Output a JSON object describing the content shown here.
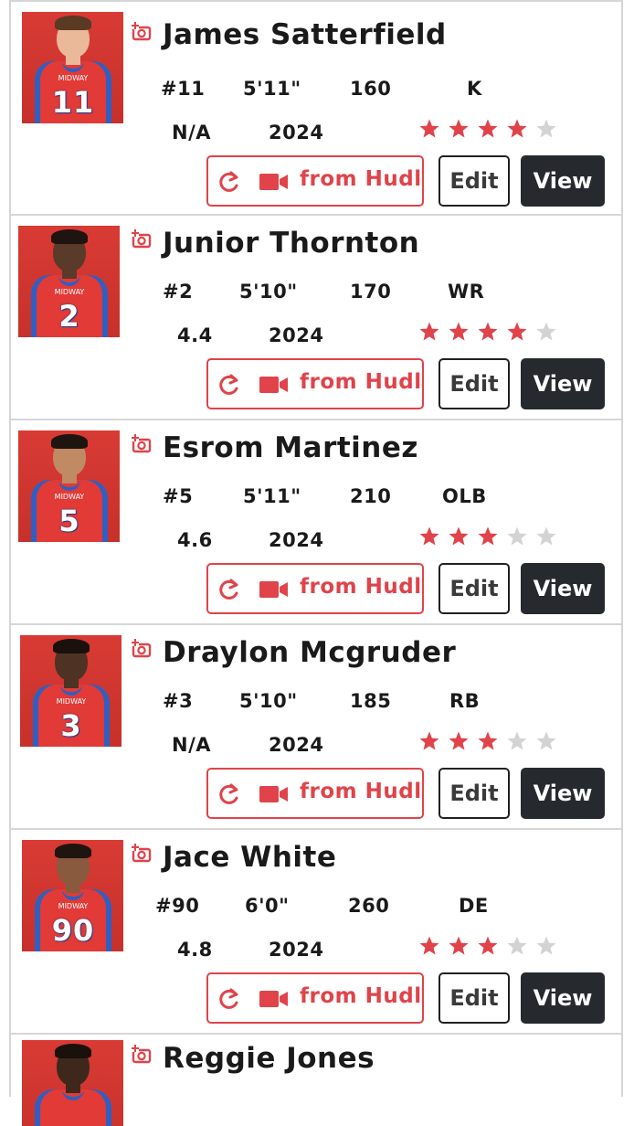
{
  "colors": {
    "accent_red": "#e0434a",
    "star_filled": "#e0434a",
    "star_empty": "#d3d3d3",
    "view_button_bg": "#262a2e",
    "border": "#d6d6d6"
  },
  "icons": {
    "add_media": "camera-plus-icon",
    "refresh": "refresh-icon",
    "video": "video-camera-icon"
  },
  "buttons": {
    "hudl_label": "from Hudl",
    "edit_label": "Edit",
    "view_label": "View"
  },
  "players": [
    {
      "name": "James Satterfield",
      "number": "#11",
      "height": "5'11\"",
      "weight": "160",
      "position": "K",
      "forty": "N/A",
      "class_year": "2024",
      "stars": 4,
      "jersey_number": "11",
      "skin": "#e9b99a",
      "hair": "#5a3a22"
    },
    {
      "name": "Junior Thornton",
      "number": "#2",
      "height": "5'10\"",
      "weight": "170",
      "position": "WR",
      "forty": "4.4",
      "class_year": "2024",
      "stars": 4,
      "jersey_number": "2",
      "skin": "#5a3a28",
      "hair": "#1e1410"
    },
    {
      "name": "Esrom Martinez",
      "number": "#5",
      "height": "5'11\"",
      "weight": "210",
      "position": "OLB",
      "forty": "4.6",
      "class_year": "2024",
      "stars": 3,
      "jersey_number": "5",
      "skin": "#c08a64",
      "hair": "#1e1410"
    },
    {
      "name": "Draylon Mcgruder",
      "number": "#3",
      "height": "5'10\"",
      "weight": "185",
      "position": "RB",
      "forty": "N/A",
      "class_year": "2024",
      "stars": 3,
      "jersey_number": "3",
      "skin": "#4e3224",
      "hair": "#1a110d"
    },
    {
      "name": "Jace White",
      "number": "#90",
      "height": "6'0\"",
      "weight": "260",
      "position": "DE",
      "forty": "4.8",
      "class_year": "2024",
      "stars": 3,
      "jersey_number": "90",
      "skin": "#8a5a3e",
      "hair": "#1e1410"
    },
    {
      "name": "Reggie Jones",
      "jersey_number": "",
      "skin": "#3e281c",
      "hair": "#1a110d"
    }
  ]
}
